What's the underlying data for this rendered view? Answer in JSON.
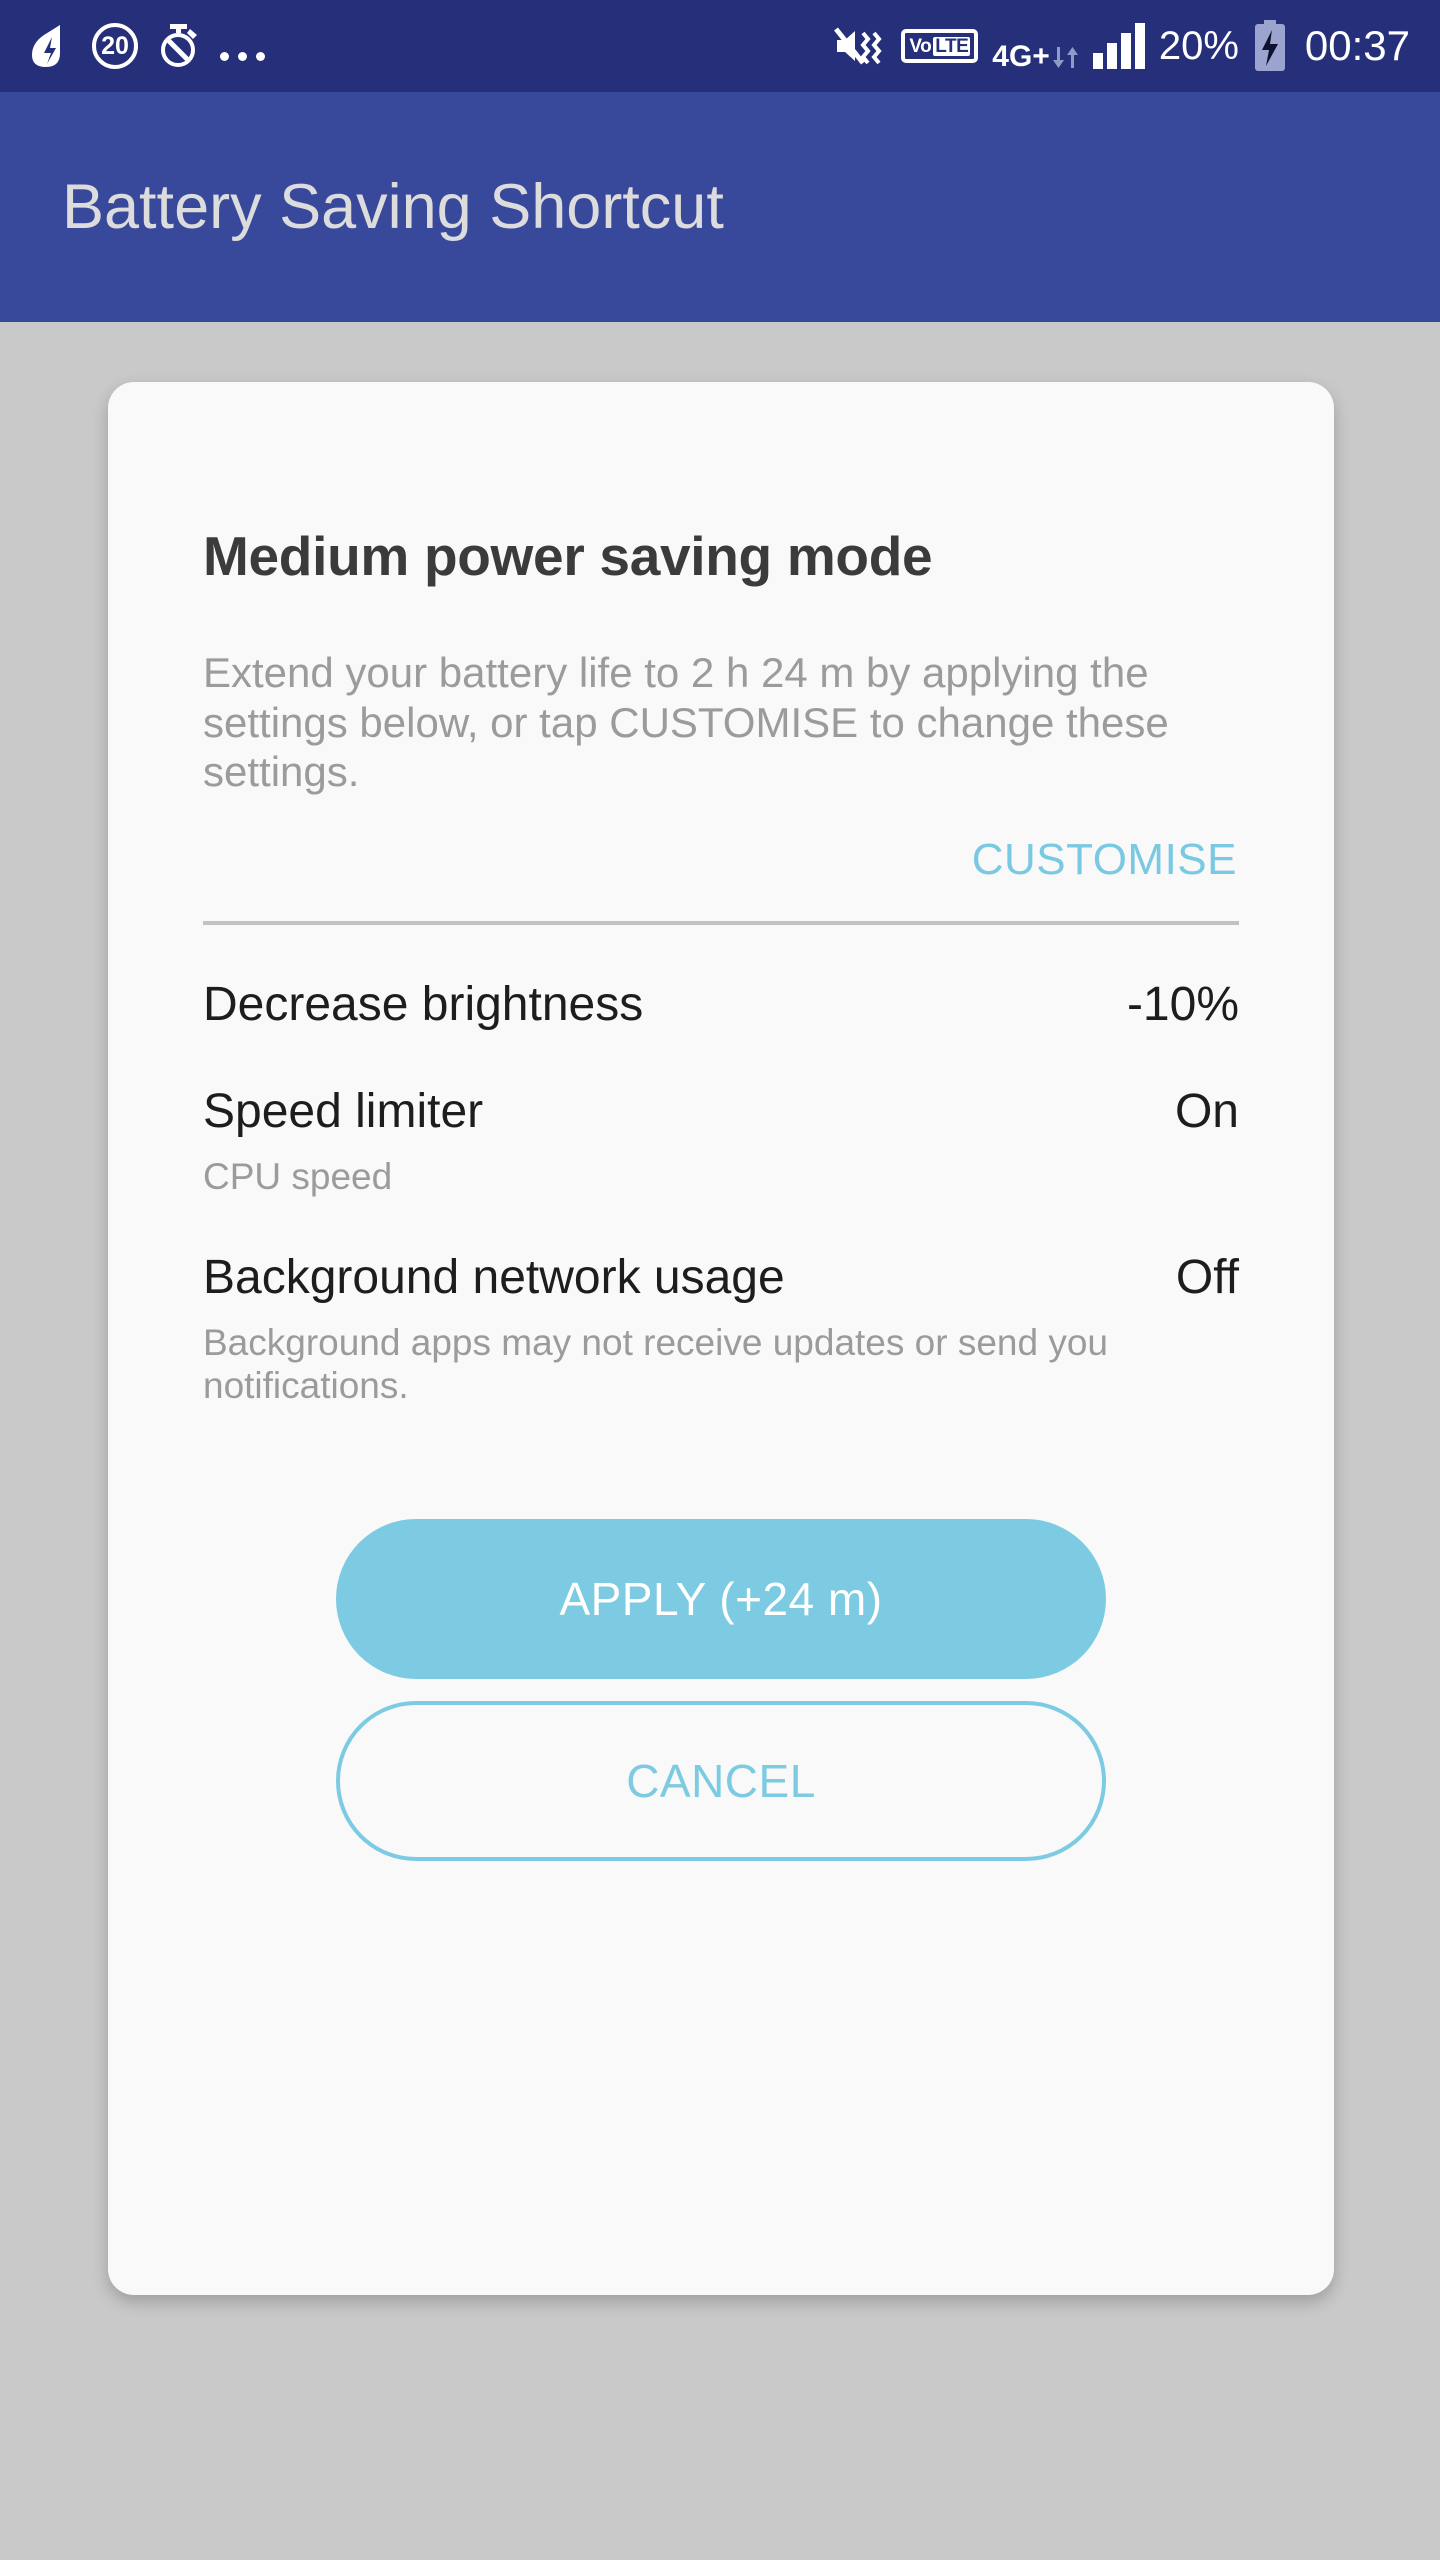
{
  "status_bar": {
    "background_color": "#26307a",
    "left_icons": [
      {
        "name": "battery-saver-app-icon",
        "glyph": "leaf"
      },
      {
        "name": "notification-count-badge",
        "label": "20"
      },
      {
        "name": "alarm-off-icon",
        "glyph": "stopwatch-slashed"
      },
      {
        "name": "more-notifications-icon",
        "glyph": "ellipsis"
      }
    ],
    "right_icons": [
      {
        "name": "mute-vibrate-icon",
        "glyph": "speaker-muted-vibrate"
      },
      {
        "name": "volte-icon",
        "vo": "Vo",
        "lte": "LTE"
      },
      {
        "name": "network-type-icon",
        "label": "4G+"
      },
      {
        "name": "signal-strength-icon",
        "bars": 4
      }
    ],
    "battery_percent": "20%",
    "battery_state": "charging",
    "clock": "00:37"
  },
  "app_bar": {
    "title": "Battery Saving Shortcut",
    "background_color": "#38499c",
    "title_color": "#dcdcdc"
  },
  "dialog": {
    "title": "Medium power saving mode",
    "description": "Extend your battery life to 2 h 24 m by applying the settings below, or tap CUSTOMISE to change these settings.",
    "customise_label": "CUSTOMISE",
    "accent_color": "#7ccbe2",
    "settings": [
      {
        "name": "Decrease brightness",
        "value": "-10%",
        "sub": ""
      },
      {
        "name": "Speed limiter",
        "value": "On",
        "sub": "CPU speed"
      },
      {
        "name": "Background network usage",
        "value": "Off",
        "sub": "Background apps may not receive updates or send you notifications."
      }
    ],
    "apply_label": "APPLY (+24 m)",
    "cancel_label": "CANCEL"
  }
}
